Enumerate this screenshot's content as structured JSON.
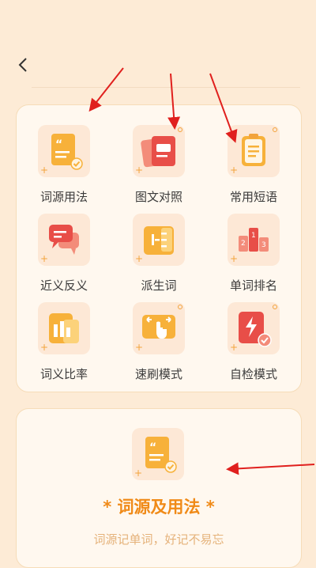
{
  "header": {
    "back_icon": "chevron-left-icon"
  },
  "grid": {
    "items": [
      {
        "label": "词源用法",
        "icon": "quote-doc-icon"
      },
      {
        "label": "图文对照",
        "icon": "image-doc-icon"
      },
      {
        "label": "常用短语",
        "icon": "clipboard-icon"
      },
      {
        "label": "近义反义",
        "icon": "chat-bubbles-icon"
      },
      {
        "label": "派生词",
        "icon": "tree-icon"
      },
      {
        "label": "单词排名",
        "icon": "podium-icon"
      },
      {
        "label": "词义比率",
        "icon": "bar-chart-icon"
      },
      {
        "label": "速刷模式",
        "icon": "swipe-hand-icon"
      },
      {
        "label": "自检模式",
        "icon": "lightning-check-icon"
      }
    ],
    "podium_numbers": [
      "2",
      "1",
      "3"
    ]
  },
  "detail": {
    "icon": "quote-doc-icon",
    "title": "* 词源及用法 *",
    "subtitle": "词源记单词，好记不易忘"
  },
  "colors": {
    "accent": "#f08a17",
    "tile_bg": "#fde8d6",
    "card_bg": "#fff8ef",
    "annotation": "#e0201e"
  }
}
